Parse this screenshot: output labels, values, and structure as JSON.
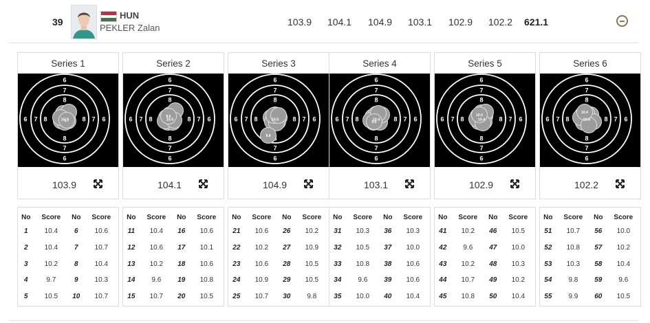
{
  "athlete": {
    "rank": "39",
    "nation": "HUN",
    "name": "PEKLER Zalan",
    "flag_colors": [
      "#ce2939",
      "#ffffff",
      "#477050"
    ],
    "total": "621.1"
  },
  "ring_labels": [
    "6",
    "7",
    "8"
  ],
  "series_labels": [
    "103.9",
    "104.1",
    "104.9",
    "103.1",
    "102.9",
    "102.2"
  ],
  "columns": {
    "no": "No",
    "score": "Score"
  },
  "series": [
    {
      "title": "Series 1",
      "score": "103.9",
      "marker_label": "10.7",
      "second_label": "9.7",
      "shots": [
        {
          "no": "1",
          "score": "10.4"
        },
        {
          "no": "2",
          "score": "10.4"
        },
        {
          "no": "3",
          "score": "10.2"
        },
        {
          "no": "4",
          "score": "9.7"
        },
        {
          "no": "5",
          "score": "10.5"
        },
        {
          "no": "6",
          "score": "10.6"
        },
        {
          "no": "7",
          "score": "10.7"
        },
        {
          "no": "8",
          "score": "10.4"
        },
        {
          "no": "9",
          "score": "10.3"
        },
        {
          "no": "10",
          "score": "10.7"
        }
      ]
    },
    {
      "title": "Series 2",
      "score": "104.1",
      "marker_label": "10.5",
      "second_label": "9.6",
      "shots": [
        {
          "no": "11",
          "score": "10.4"
        },
        {
          "no": "12",
          "score": "10.6"
        },
        {
          "no": "13",
          "score": "10.2"
        },
        {
          "no": "14",
          "score": "9.6"
        },
        {
          "no": "15",
          "score": "10.7"
        },
        {
          "no": "16",
          "score": "10.6"
        },
        {
          "no": "17",
          "score": "10.1"
        },
        {
          "no": "18",
          "score": "10.6"
        },
        {
          "no": "19",
          "score": "10.8"
        },
        {
          "no": "20",
          "score": "10.5"
        }
      ]
    },
    {
      "title": "Series 3",
      "score": "104.9",
      "marker_label": "10.5",
      "second_label": "9.8",
      "shots": [
        {
          "no": "21",
          "score": "10.6"
        },
        {
          "no": "22",
          "score": "10.2"
        },
        {
          "no": "23",
          "score": "10.6"
        },
        {
          "no": "24",
          "score": "10.9"
        },
        {
          "no": "25",
          "score": "10.7"
        },
        {
          "no": "26",
          "score": "10.2"
        },
        {
          "no": "27",
          "score": "10.9"
        },
        {
          "no": "28",
          "score": "10.5"
        },
        {
          "no": "29",
          "score": "10.5"
        },
        {
          "no": "30",
          "score": "9.8"
        }
      ]
    },
    {
      "title": "Series 4",
      "score": "103.1",
      "marker_label": "10.4",
      "second_label": "9.6",
      "shots": [
        {
          "no": "31",
          "score": "10.3"
        },
        {
          "no": "32",
          "score": "10.5"
        },
        {
          "no": "33",
          "score": "10.8"
        },
        {
          "no": "34",
          "score": "9.6"
        },
        {
          "no": "35",
          "score": "10.0"
        },
        {
          "no": "36",
          "score": "10.3"
        },
        {
          "no": "37",
          "score": "10.0"
        },
        {
          "no": "38",
          "score": "10.6"
        },
        {
          "no": "39",
          "score": "10.6"
        },
        {
          "no": "40",
          "score": "10.4"
        }
      ]
    },
    {
      "title": "Series 5",
      "score": "102.9",
      "marker_label": "10.4",
      "second_label": "10.0",
      "shots": [
        {
          "no": "41",
          "score": "10.2"
        },
        {
          "no": "42",
          "score": "9.6"
        },
        {
          "no": "43",
          "score": "10.2"
        },
        {
          "no": "44",
          "score": "10.7"
        },
        {
          "no": "45",
          "score": "10.8"
        },
        {
          "no": "46",
          "score": "10.5"
        },
        {
          "no": "47",
          "score": "10.0"
        },
        {
          "no": "48",
          "score": "10.3"
        },
        {
          "no": "49",
          "score": "10.2"
        },
        {
          "no": "50",
          "score": "10.4"
        }
      ]
    },
    {
      "title": "Series 6",
      "score": "102.2",
      "marker_label": "10.5",
      "second_label": "10.4",
      "shots": [
        {
          "no": "51",
          "score": "10.7"
        },
        {
          "no": "52",
          "score": "10.8"
        },
        {
          "no": "53",
          "score": "10.3"
        },
        {
          "no": "54",
          "score": "9.8"
        },
        {
          "no": "55",
          "score": "9.9"
        },
        {
          "no": "56",
          "score": "10.0"
        },
        {
          "no": "57",
          "score": "10.2"
        },
        {
          "no": "58",
          "score": "10.4"
        },
        {
          "no": "59",
          "score": "9.6"
        },
        {
          "no": "60",
          "score": "10.5"
        }
      ]
    }
  ]
}
